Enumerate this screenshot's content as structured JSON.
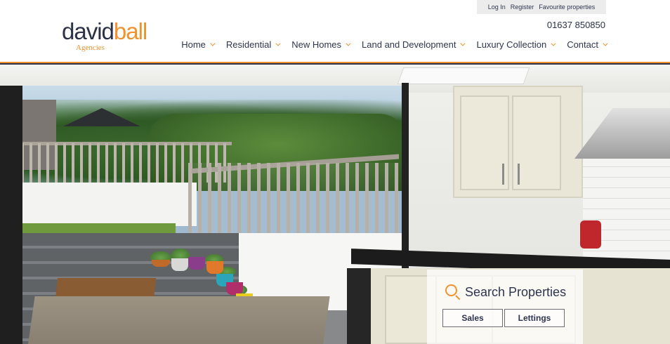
{
  "topbar": {
    "login": "Log In",
    "register": "Register",
    "favourites": "Favourite properties"
  },
  "logo": {
    "word1": "david",
    "word2": "ball",
    "sub": "Agencies"
  },
  "phone": "01637 850850",
  "nav": [
    {
      "label": "Home"
    },
    {
      "label": "Residential"
    },
    {
      "label": "New Homes"
    },
    {
      "label": "Land and Development"
    },
    {
      "label": "Luxury Collection"
    },
    {
      "label": "Contact"
    }
  ],
  "search": {
    "title": "Search Properties",
    "sales_label": "Sales",
    "lettings_label": "Lettings"
  },
  "colors": {
    "brand_dark": "#2b3248",
    "brand_orange": "#f2922e"
  },
  "icons": {
    "search": "magnifier-icon",
    "nav_dropdown": "chevron-down-icon"
  }
}
